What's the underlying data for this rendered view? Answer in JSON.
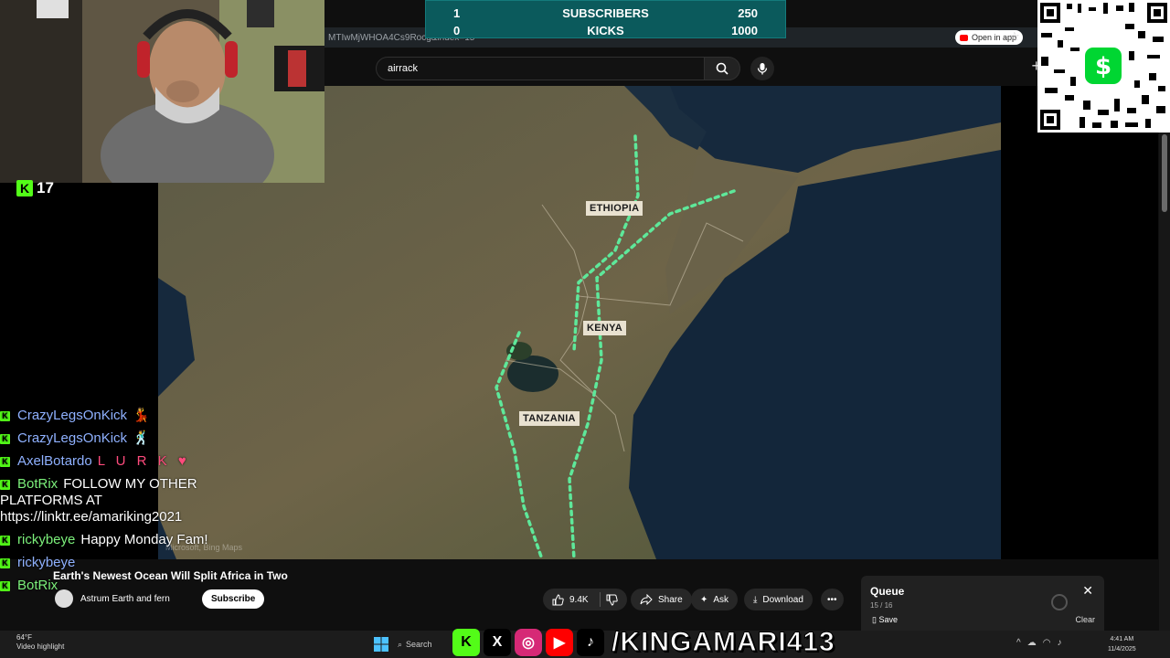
{
  "goal": {
    "subscribers_current": "1",
    "subscribers_label": "SUBSCRIBERS",
    "subscribers_goal": "250",
    "kicks_current": "0",
    "kicks_label": "KICKS",
    "kicks_goal": "1000"
  },
  "browser": {
    "url_fragment": "MTIwMjWHOA4Cs9Rocg&index=15",
    "open_in_app": "Open in app"
  },
  "youtube": {
    "search_value": "airrack",
    "video_title": "Earth's Newest Ocean Will Split Africa in Two",
    "channel_name": "Astrum Earth and fern",
    "subscribe_label": "Subscribe",
    "like_count": "9.4K",
    "share_label": "Share",
    "ask_label": "Ask",
    "download_label": "Download",
    "map_watermark": "Microsoft, Bing Maps"
  },
  "map_labels": {
    "ethiopia": "ETHIOPIA",
    "kenya": "KENYA",
    "tanzania": "TANZANIA"
  },
  "queue": {
    "title": "Queue",
    "count": "15 / 16",
    "save_label": "Save",
    "clear_label": "Clear"
  },
  "stream": {
    "kick_viewers": "17",
    "handle": "/KINGAMARI413"
  },
  "chat": [
    {
      "user": "CrazyLegsOnKick",
      "text": "",
      "user_color": "#8fb1ff"
    },
    {
      "user": "CrazyLegsOnKick",
      "text": "",
      "user_color": "#8fb1ff"
    },
    {
      "user": "AxelBotardo",
      "text": "L U R K ♥",
      "user_color": "#8fb1ff"
    },
    {
      "user": "BotRix",
      "text": "FOLLOW MY OTHER PLATFORMS AT https://linktr.ee/amariking2021",
      "user_color": "#7cf07b"
    },
    {
      "user": "rickybeye",
      "text": "Happy Monday Fam!",
      "user_color": "#7cf07b"
    },
    {
      "user": "rickybeye",
      "text": "",
      "user_color": "#8fb1ff"
    },
    {
      "user": "BotRix",
      "text": "",
      "user_color": "#7cf07b"
    }
  ],
  "taskbar": {
    "weather_temp": "64°F",
    "weather_desc": "Video highlight",
    "search_label": "Search",
    "time": "4:41 AM",
    "date": "11/4/2025"
  },
  "colors": {
    "kick_green": "#53fc18",
    "route_dots": "#5ee89a",
    "goal_bg": "#0b5a5c"
  }
}
